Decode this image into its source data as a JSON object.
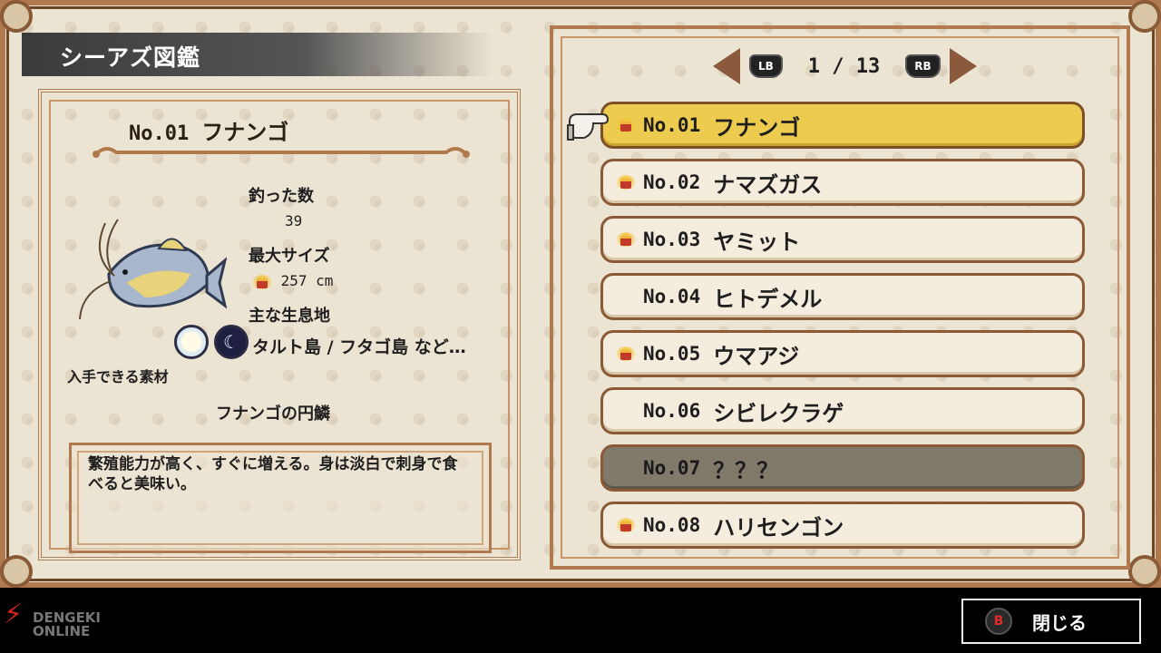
{
  "screen_title": "シーアズ図鑑",
  "detail": {
    "number": "No.01",
    "name": "フナンゴ",
    "caught_label": "釣った数",
    "caught_value": "39",
    "max_size_label": "最大サイズ",
    "max_size_value": "257 cm",
    "habitat_label": "主な生息地",
    "habitat_value": "タルト島 / フタゴ島 など…",
    "materials_label": "入手できる素材",
    "material_name": "フナンゴの円鱗",
    "description": "繁殖能力が高く、すぐに増える。身は淡白で刺身で食べると美味い。"
  },
  "pager": {
    "left_button": "LB",
    "right_button": "RB",
    "page": "1 / 13"
  },
  "list": [
    {
      "num": "No.01",
      "name": "フナンゴ",
      "crown": true,
      "state": "selected"
    },
    {
      "num": "No.02",
      "name": "ナマズガス",
      "crown": true,
      "state": "normal"
    },
    {
      "num": "No.03",
      "name": "ヤミット",
      "crown": true,
      "state": "normal"
    },
    {
      "num": "No.04",
      "name": "ヒトデメル",
      "crown": false,
      "state": "normal"
    },
    {
      "num": "No.05",
      "name": "ウマアジ",
      "crown": true,
      "state": "normal"
    },
    {
      "num": "No.06",
      "name": "シビレクラゲ",
      "crown": false,
      "state": "normal"
    },
    {
      "num": "No.07",
      "name": "？？？",
      "crown": false,
      "state": "unknown"
    },
    {
      "num": "No.08",
      "name": "ハリセンゴン",
      "crown": true,
      "state": "normal"
    }
  ],
  "footer": {
    "close_label": "閉じる",
    "logo_line1": "DENGEKI",
    "logo_line2": "ONLINE"
  },
  "colors": {
    "frame": "#b07a4e",
    "selected_row": "#eccb4e",
    "unknown_row": "#817a6a",
    "row": "#f4ecdc"
  }
}
